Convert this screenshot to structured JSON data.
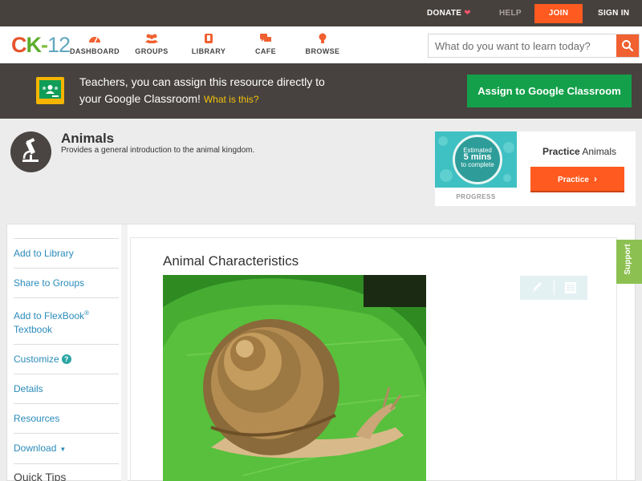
{
  "topbar": {
    "donate": "DONATE",
    "help": "HELP",
    "join": "JOIN",
    "signin": "SIGN IN"
  },
  "logo": {
    "c": "C",
    "k": "K",
    "dash": "-",
    "num": "12"
  },
  "nav": {
    "items": [
      {
        "label": "DASHBOARD",
        "icon": "dashboard-icon"
      },
      {
        "label": "GROUPS",
        "icon": "groups-icon"
      },
      {
        "label": "LIBRARY",
        "icon": "library-icon"
      },
      {
        "label": "CAFE",
        "icon": "cafe-icon"
      },
      {
        "label": "BROWSE",
        "icon": "browse-icon"
      }
    ],
    "search_placeholder": "What do you want to learn today?"
  },
  "banner": {
    "line1": "Teachers, you can assign this resource directly to",
    "line2": "your Google Classroom!",
    "what": "What is this?",
    "assign_label": "Assign to Google Classroom"
  },
  "concept": {
    "title": "Animals",
    "description": "Provides a general introduction to the animal kingdom."
  },
  "practice": {
    "estimated": "Estimated",
    "mins": "5 mins",
    "to_complete": "to complete",
    "progress_label": "PROGRESS",
    "title_bold": "Practice",
    "title_rest": "Animals",
    "button_label": "Practice"
  },
  "sidebar": {
    "items": [
      {
        "label": "Add to Library"
      },
      {
        "label": "Share to Groups"
      },
      {
        "label": "Add to FlexBook",
        "sup": "®",
        "label2": "Textbook"
      },
      {
        "label": "Customize",
        "badge": "?"
      },
      {
        "label": "Details"
      },
      {
        "label": "Resources"
      },
      {
        "label": "Download",
        "caret": "▼"
      }
    ],
    "quick_tips": "Quick Tips"
  },
  "article": {
    "title": "Animal Characteristics"
  },
  "support": {
    "label": "Support"
  },
  "colors": {
    "accent": "#ff5a1f",
    "banner": "#47423f",
    "google_green": "#14a04b",
    "link": "#2a8bba",
    "support": "#8cc152"
  }
}
